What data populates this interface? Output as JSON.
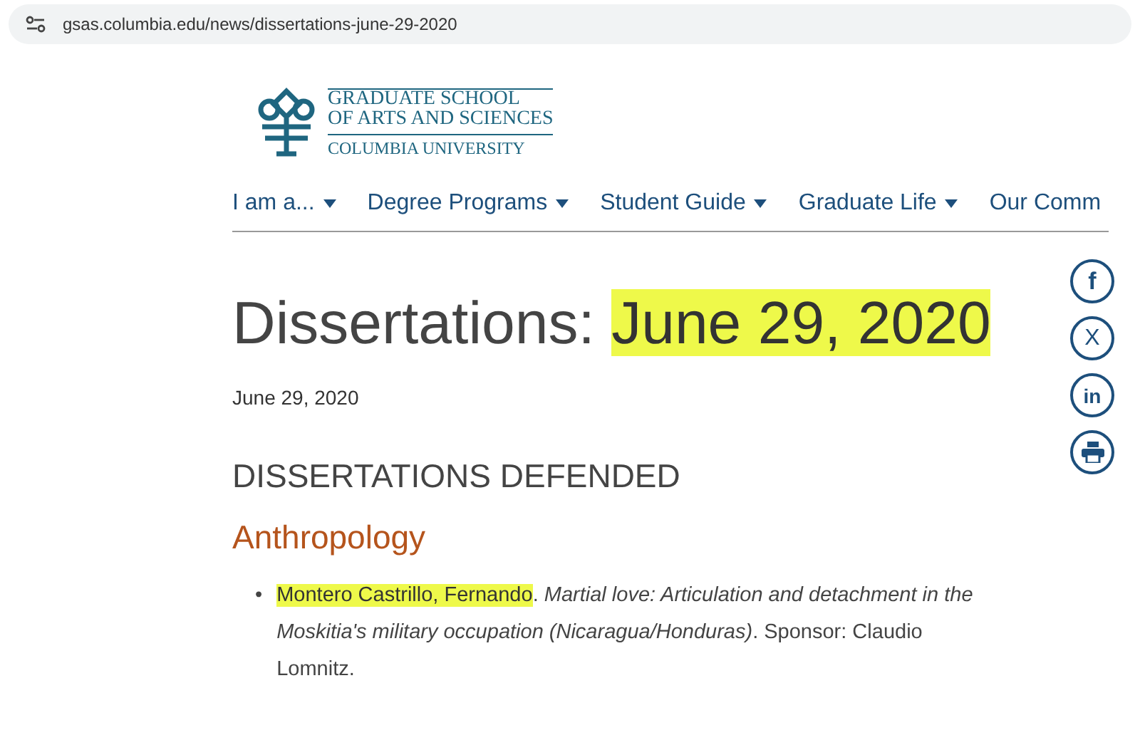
{
  "address_bar": {
    "url": "gsas.columbia.edu/news/dissertations-june-29-2020"
  },
  "logo": {
    "lines": [
      "GRADUATE SCHOOL",
      "OF ARTS AND SCIENCES",
      "COLUMBIA UNIVERSITY"
    ]
  },
  "nav": [
    {
      "label": "I am a...",
      "caret": true
    },
    {
      "label": "Degree Programs",
      "caret": true
    },
    {
      "label": "Student Guide",
      "caret": true
    },
    {
      "label": "Graduate Life",
      "caret": true
    },
    {
      "label": "Our Comm",
      "caret": false
    }
  ],
  "title": {
    "parts": [
      {
        "text": "Dissertations: ",
        "highlighted": false
      },
      {
        "text": "June 29, 2020",
        "highlighted": true
      }
    ]
  },
  "date": "June 29, 2020",
  "section_heading": "DISSERTATIONS DEFENDED",
  "departments": [
    {
      "name": "Anthropology",
      "entries": [
        {
          "bullet": "•",
          "author": "Montero Castrillo, Fernando",
          "author_highlighted": true,
          "after_author": ".",
          "work": "Martial love: Articulation and detachment in the Moskitia's military occupation (Nicaragua/Honduras)",
          "rest": ". Sponsor: Claudio Lomnitz."
        }
      ]
    }
  ],
  "share": [
    {
      "kind": "facebook",
      "glyph": "f"
    },
    {
      "kind": "x",
      "glyph": "X"
    },
    {
      "kind": "linkedin",
      "glyph": "in"
    },
    {
      "kind": "print"
    }
  ]
}
